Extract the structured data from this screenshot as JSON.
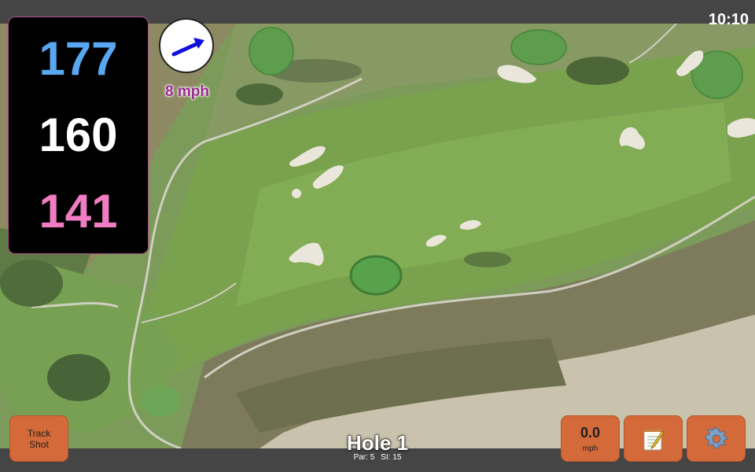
{
  "status": {
    "time": "10:10"
  },
  "distances": {
    "back": "177",
    "middle": "160",
    "front": "141"
  },
  "wind": {
    "speed_label": "8 mph",
    "icon": "wind-arrow-icon",
    "arrow_color": "#1010e0"
  },
  "buttons": {
    "track_shot_line1": "Track",
    "track_shot_line2": "Shot",
    "speed_value": "0.0",
    "speed_unit": "mph",
    "notes_icon": "notepad-icon",
    "settings_icon": "gear-icon"
  },
  "hole": {
    "title": "Hole 1",
    "par": "Par: 5",
    "si": "SI: 15"
  },
  "colors": {
    "back_distance": "#59a7f1",
    "middle_distance": "#ffffff",
    "front_distance": "#f07cc3",
    "button": "#d46a3a",
    "wind_text": "#9b2a8e"
  }
}
